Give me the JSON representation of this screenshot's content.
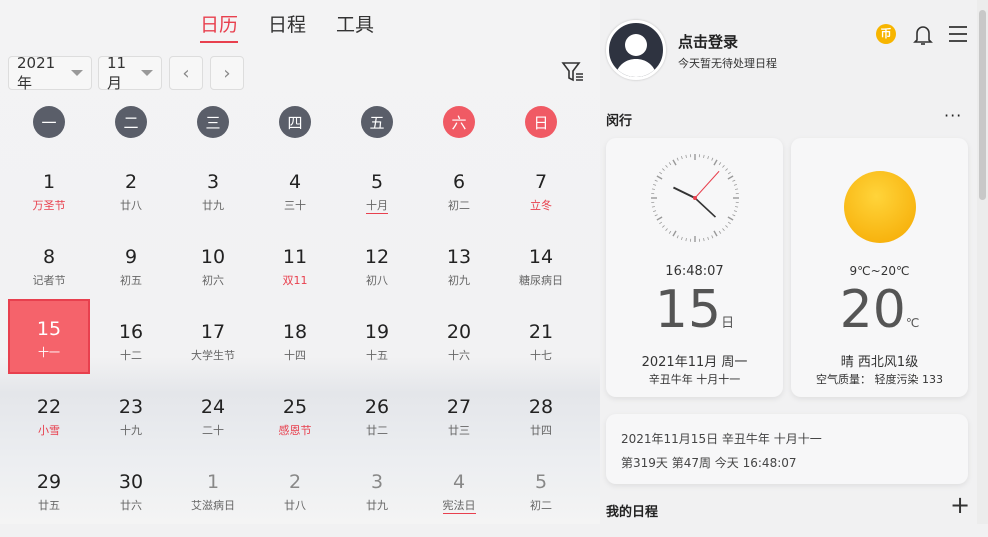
{
  "tabs": [
    "日历",
    "日程",
    "工具"
  ],
  "year_select": "2021年",
  "month_select": "11月",
  "weekdays": [
    "一",
    "二",
    "三",
    "四",
    "五",
    "六",
    "日"
  ],
  "days": [
    {
      "n": "1",
      "l": "万圣节",
      "red": true
    },
    {
      "n": "2",
      "l": "廿八"
    },
    {
      "n": "3",
      "l": "廿九"
    },
    {
      "n": "4",
      "l": "三十"
    },
    {
      "n": "5",
      "l": "十月",
      "ul": true
    },
    {
      "n": "6",
      "l": "初二"
    },
    {
      "n": "7",
      "l": "立冬",
      "red": true
    },
    {
      "n": "8",
      "l": "记者节"
    },
    {
      "n": "9",
      "l": "初五"
    },
    {
      "n": "10",
      "l": "初六"
    },
    {
      "n": "11",
      "l": "双11",
      "red": true
    },
    {
      "n": "12",
      "l": "初八"
    },
    {
      "n": "13",
      "l": "初九"
    },
    {
      "n": "14",
      "l": "糖尿病日"
    },
    {
      "n": "15",
      "l": "十一",
      "today": true
    },
    {
      "n": "16",
      "l": "十二"
    },
    {
      "n": "17",
      "l": "大学生节"
    },
    {
      "n": "18",
      "l": "十四"
    },
    {
      "n": "19",
      "l": "十五"
    },
    {
      "n": "20",
      "l": "十六"
    },
    {
      "n": "21",
      "l": "十七"
    },
    {
      "n": "22",
      "l": "小雪",
      "red": true
    },
    {
      "n": "23",
      "l": "十九"
    },
    {
      "n": "24",
      "l": "二十"
    },
    {
      "n": "25",
      "l": "感恩节",
      "red": true
    },
    {
      "n": "26",
      "l": "廿二"
    },
    {
      "n": "27",
      "l": "廿三"
    },
    {
      "n": "28",
      "l": "廿四"
    },
    {
      "n": "29",
      "l": "廿五"
    },
    {
      "n": "30",
      "l": "廿六"
    },
    {
      "n": "1",
      "l": "艾滋病日",
      "other": true
    },
    {
      "n": "2",
      "l": "廿八",
      "other": true
    },
    {
      "n": "3",
      "l": "廿九",
      "other": true
    },
    {
      "n": "4",
      "l": "宪法日",
      "other": true,
      "ul": true
    },
    {
      "n": "5",
      "l": "初二",
      "other": true
    }
  ],
  "user": {
    "login": "点击登录",
    "sub": "今天暂无待处理日程"
  },
  "coin_icon": "币",
  "section_title": "闵行",
  "clock": {
    "time": "16:48:07",
    "day": "15",
    "day_unit": "日",
    "date": "2021年11月 周一",
    "lunar": "辛丑牛年 十月十一"
  },
  "weather": {
    "range": "9℃~20℃",
    "temp": "20",
    "unit": "℃",
    "desc": "晴 西北风1级",
    "aqi": "空气质量： 轻度污染 133"
  },
  "info": {
    "line1": "2021年11月15日 辛丑牛年 十月十一",
    "line2": "第319天 第47周 今天 16:48:07"
  },
  "my_schedule": "我的日程"
}
